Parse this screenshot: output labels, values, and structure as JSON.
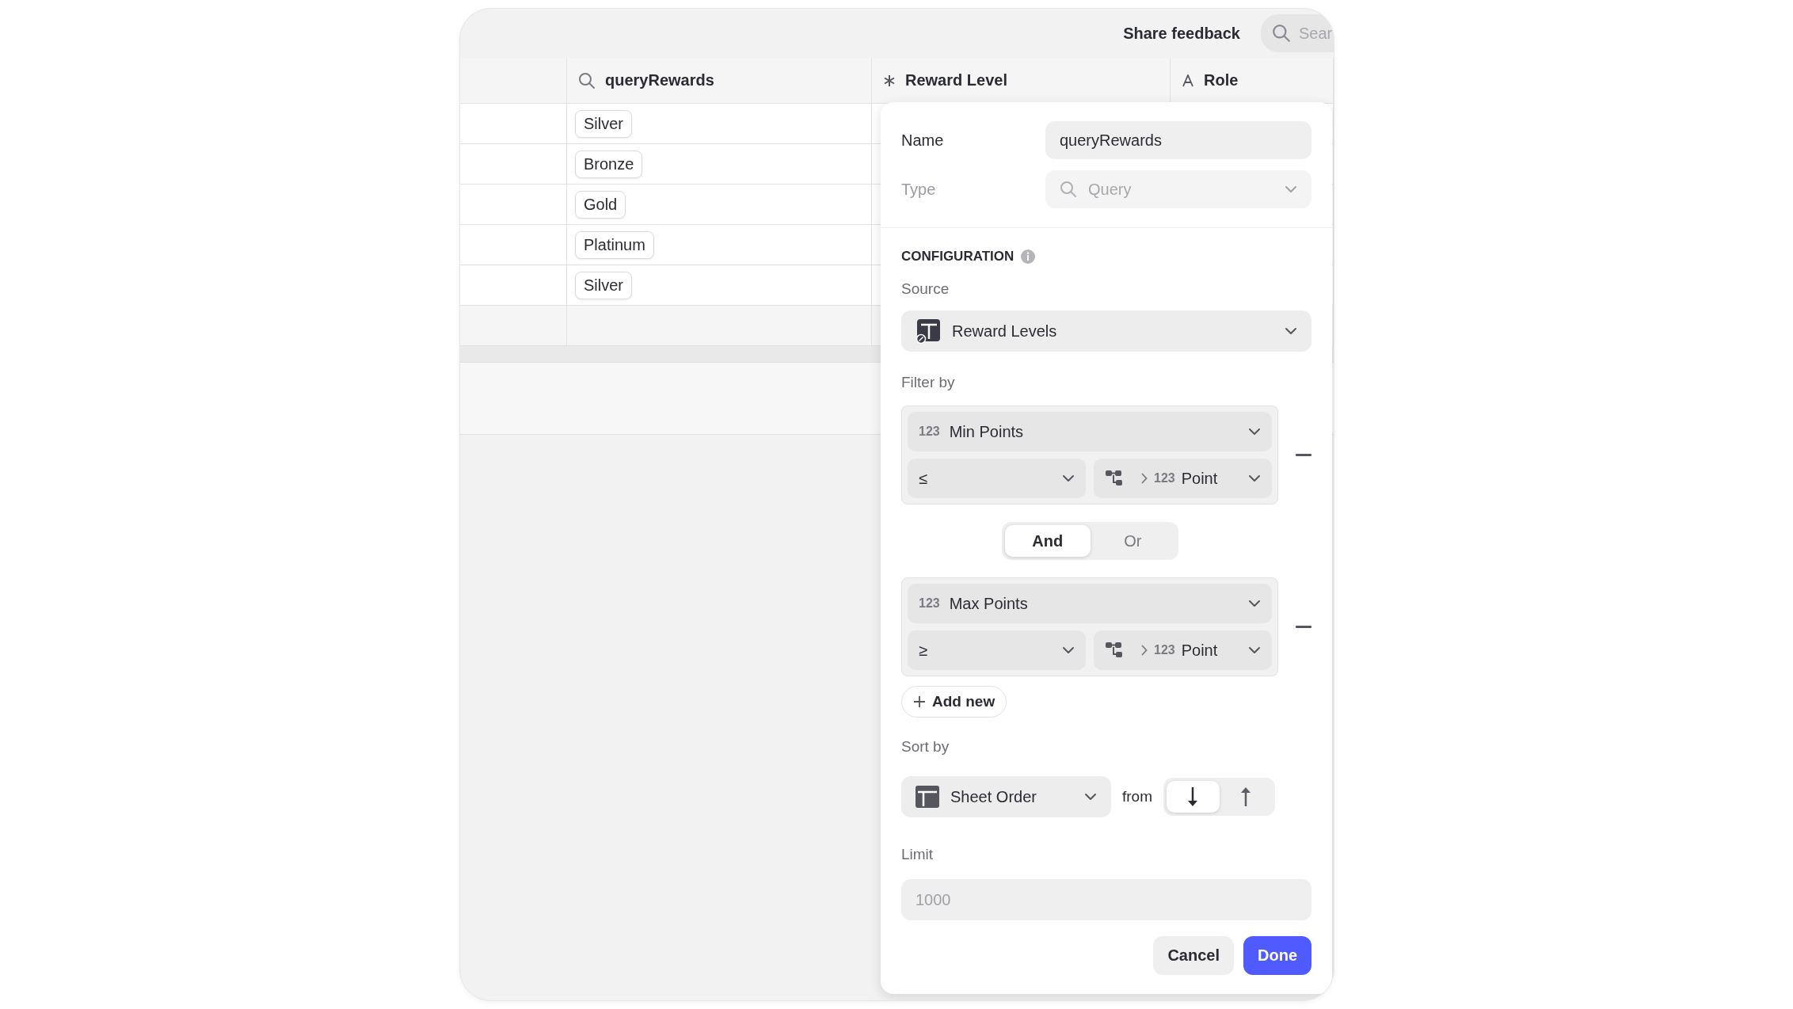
{
  "topbar": {
    "feedback": "Share feedback",
    "search": {
      "placeholder": "Sear"
    }
  },
  "table": {
    "columns": [
      {
        "kind": "query",
        "label": "queryRewards"
      },
      {
        "kind": "select",
        "label": "Reward Level"
      },
      {
        "kind": "text",
        "label": "Role"
      }
    ],
    "rows": [
      {
        "tag": "Silver"
      },
      {
        "tag": "Bronze"
      },
      {
        "tag": "Gold"
      },
      {
        "tag": "Platinum"
      },
      {
        "tag": "Silver"
      }
    ]
  },
  "panel": {
    "name": {
      "label": "Name",
      "value": "queryRewards"
    },
    "type": {
      "label": "Type",
      "value": "Query",
      "disabled": true
    },
    "config_title": "CONFIGURATION",
    "source": {
      "label": "Source",
      "value": "Reward Levels"
    },
    "filter_label": "Filter by",
    "filters": [
      {
        "field_type": "123",
        "field": "Min Points",
        "operator": "≤",
        "value_type": "123",
        "value": "Point"
      },
      {
        "field_type": "123",
        "field": "Max Points",
        "operator": "≥",
        "value_type": "123",
        "value": "Point"
      }
    ],
    "conjunctions": [
      {
        "label": "And",
        "selected": true
      },
      {
        "label": "Or",
        "selected": false
      }
    ],
    "add_label": "Add new",
    "sort": {
      "label": "Sort by",
      "value": "Sheet Order",
      "from": "from",
      "directions": [
        {
          "kind": "down",
          "selected": true
        },
        {
          "kind": "up",
          "selected": false
        }
      ]
    },
    "limit": {
      "label": "Limit",
      "placeholder": "1000"
    },
    "buttons": [
      {
        "kind": "secondary",
        "label": "Cancel"
      },
      {
        "kind": "primary",
        "label": "Done"
      }
    ]
  }
}
